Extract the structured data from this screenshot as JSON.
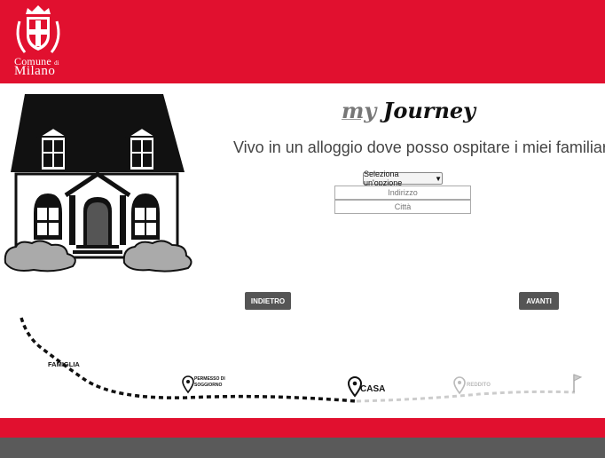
{
  "header": {
    "logo_line1": "Comune",
    "logo_line1_small": "di",
    "logo_line2": "Milano",
    "brand_color": "#e1102f"
  },
  "main": {
    "title_my": "my",
    "title_journey": "Journey",
    "question": "Vivo in un alloggio dove posso ospitare i miei familiari",
    "select_value": "Seleziona un'opzione",
    "address_placeholder": "Indirizzo",
    "city_placeholder": "Città"
  },
  "nav": {
    "back_label": "INDIETRO",
    "next_label": "AVANTI"
  },
  "journey": {
    "steps": [
      {
        "label": "FAMIGLIA",
        "state": "done"
      },
      {
        "label_line1": "PERMESSO DI",
        "label_line2": "SOGGIORNO",
        "state": "done",
        "icon": "map-pin-icon"
      },
      {
        "label": "CASA",
        "state": "current",
        "icon": "map-pin-icon"
      },
      {
        "label": "REDDITO",
        "state": "todo",
        "icon": "map-pin-icon"
      },
      {
        "label": "",
        "state": "todo",
        "icon": "finish-flag-icon"
      }
    ]
  },
  "footer": {
    "red": "#e1102f",
    "grey": "#5a5a5a"
  }
}
